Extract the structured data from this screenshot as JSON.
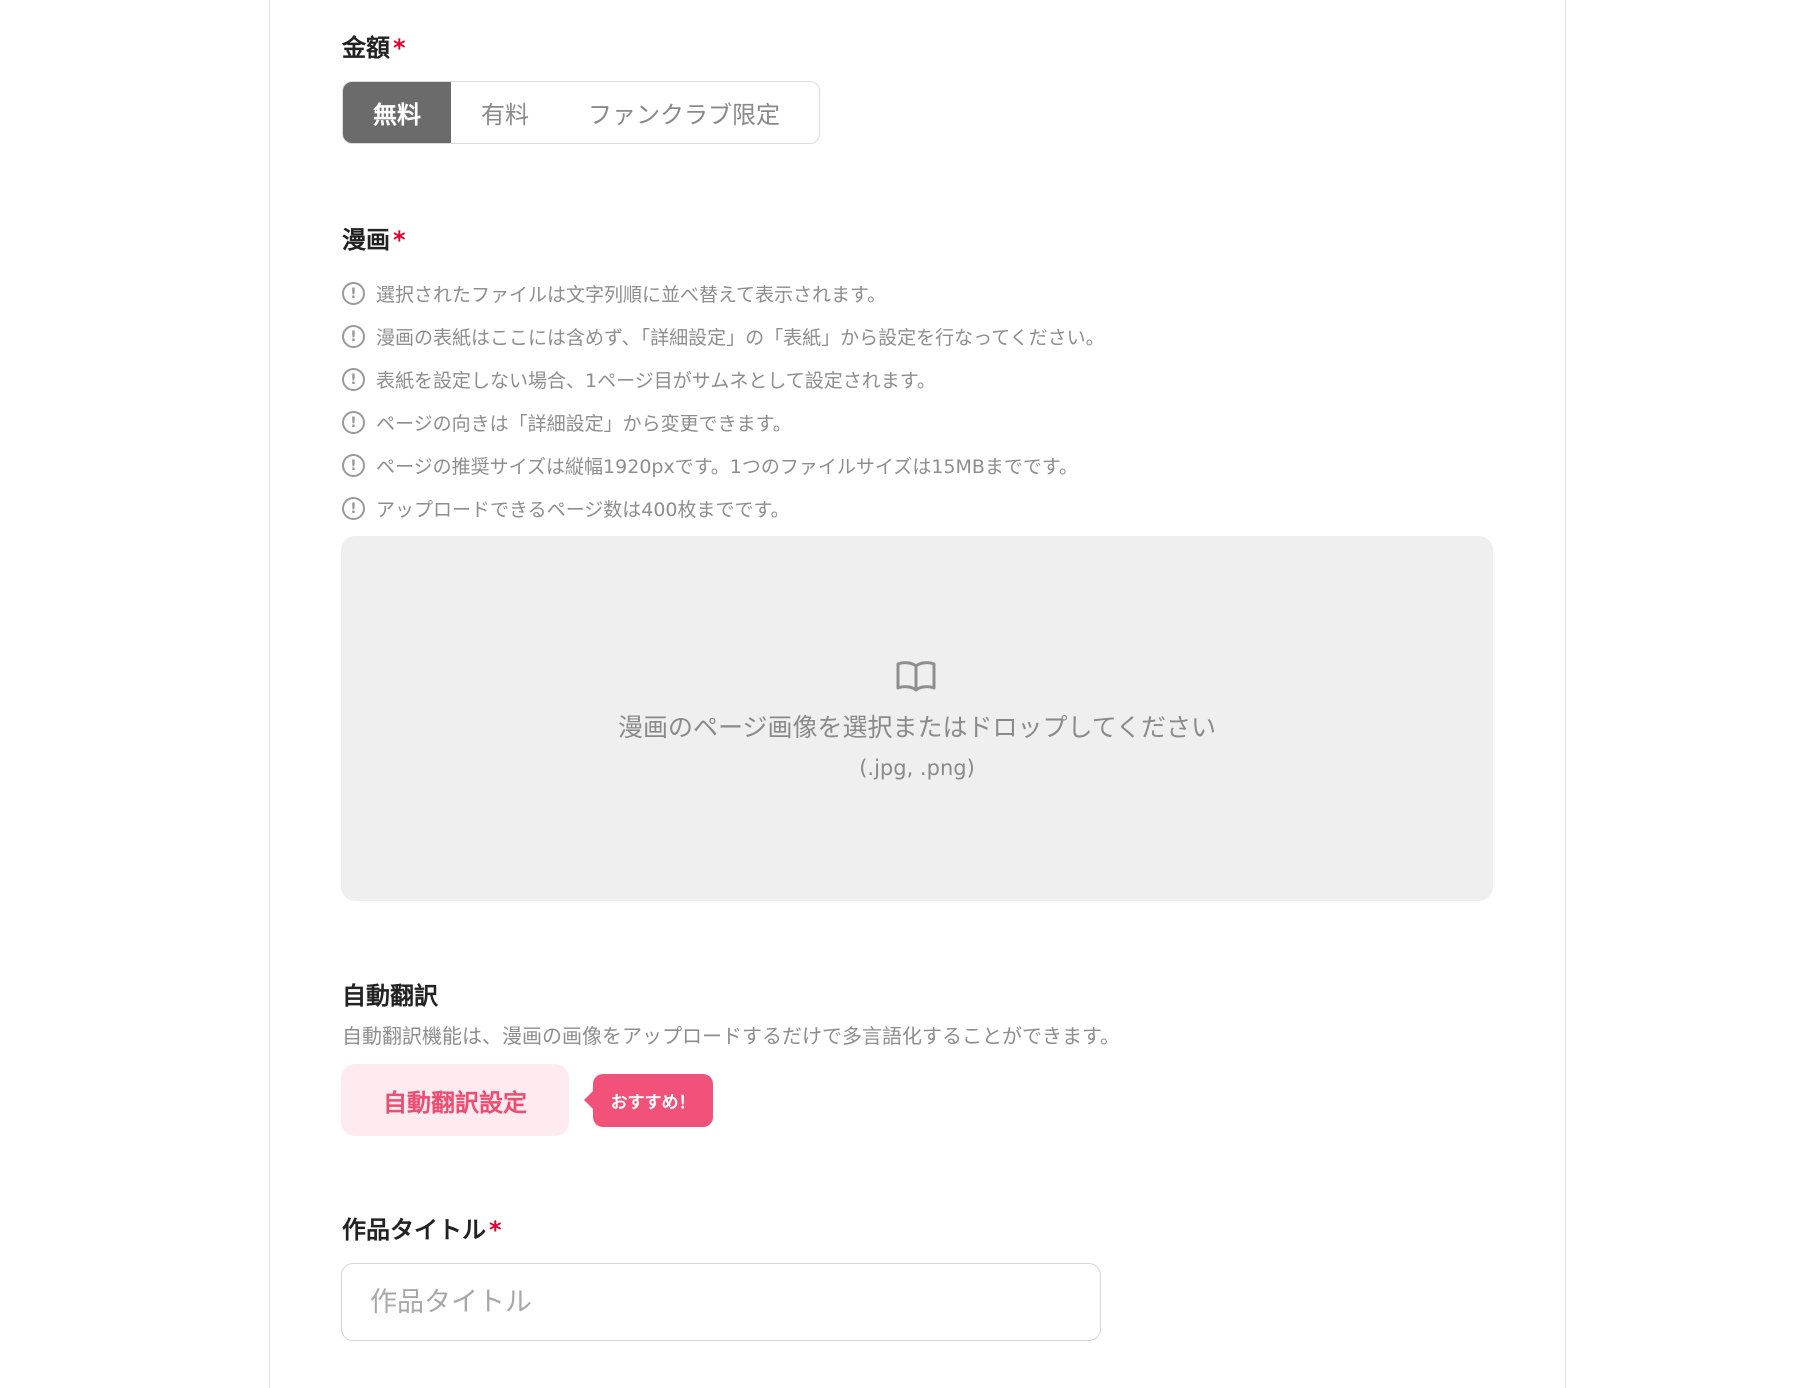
{
  "price": {
    "label": "金額",
    "required_mark": "*",
    "options": [
      "無料",
      "有料",
      "ファンクラブ限定"
    ],
    "selected": "無料"
  },
  "manga": {
    "label": "漫画",
    "required_mark": "*",
    "notes": [
      "選択されたファイルは文字列順に並べ替えて表示されます。",
      "漫画の表紙はここには含めず、「詳細設定」の「表紙」から設定を行なってください。",
      "表紙を設定しない場合、1ページ目がサムネとして設定されます。",
      "ページの向きは「詳細設定」から変更できます。",
      "ページの推奨サイズは縦幅1920pxです。1つのファイルサイズは15MBまでです。",
      "アップロードできるページ数は400枚までです。"
    ],
    "note_icon": "exclamation-circle-icon",
    "dropzone": {
      "icon": "book-icon",
      "text": "漫画のページ画像を選択またはドロップしてください",
      "formats": "(.jpg, .png)"
    }
  },
  "auto_translate": {
    "label": "自動翻訳",
    "description": "自動翻訳機能は、漫画の画像をアップロードするだけで多言語化することができます。",
    "button_label": "自動翻訳設定",
    "badge": "おすすめ！"
  },
  "work_title": {
    "label": "作品タイトル",
    "required_mark": "*",
    "placeholder": "作品タイトル",
    "value": ""
  },
  "colors": {
    "accent_pink": "#f25179",
    "required_red": "#e0002a",
    "selected_segment": "#6b6b6b"
  }
}
